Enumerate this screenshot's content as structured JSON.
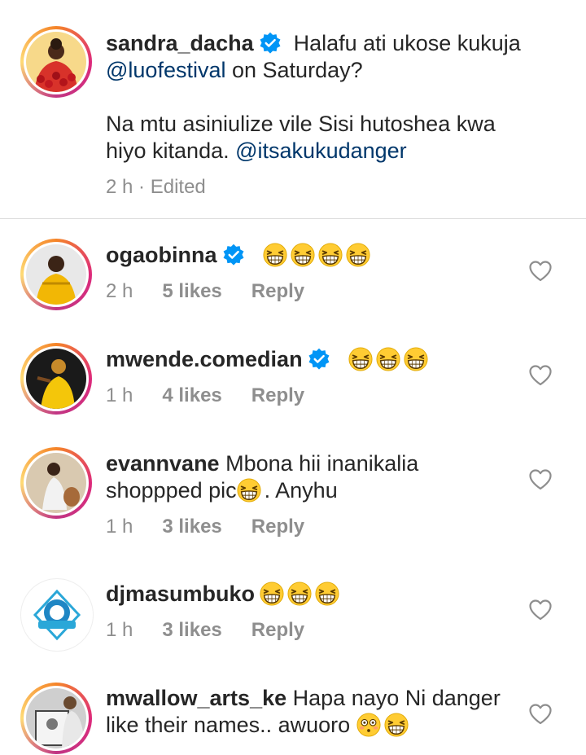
{
  "post": {
    "username": "sandra_dacha",
    "line1": "Halafu ati ukose kukuja",
    "mention1": "@luofestival",
    "line1b": "on Saturday?",
    "line2": "Na mtu asiniulize vile Sisi hutoshea kwa",
    "line3": "hiyo kitanda.",
    "mention2": "@itsakukudanger",
    "time": "2 h",
    "sep": "·",
    "edited": "Edited"
  },
  "comments": [
    {
      "username": "ogaobinna",
      "verified": true,
      "text": "",
      "emoji": [
        "grinning-squint-face",
        "grinning-squint-face",
        "grinning-squint-face",
        "grinning-squint-face"
      ],
      "time": "2 h",
      "likes": "5 likes",
      "reply": "Reply"
    },
    {
      "username": "mwende.comedian",
      "verified": true,
      "text": "",
      "emoji": [
        "grinning-squint-face",
        "grinning-squint-face",
        "grinning-squint-face"
      ],
      "time": "1 h",
      "likes": "4 likes",
      "reply": "Reply"
    },
    {
      "username": "evannvane",
      "verified": false,
      "text1": "Mbona hii inanikalia",
      "text2a": "shoppped pic",
      "text2b": ". Anyhu",
      "time": "1 h",
      "likes": "3 likes",
      "reply": "Reply"
    },
    {
      "username": "djmasumbuko",
      "verified": false,
      "emoji": [
        "grinning-squint-face",
        "grinning-squint-face",
        "grinning-squint-face"
      ],
      "time": "1 h",
      "likes": "3 likes",
      "reply": "Reply"
    },
    {
      "username": "mwallow_arts_ke",
      "verified": false,
      "text1": "Hapa nayo Ni danger",
      "text2": "like their names.. awuoro",
      "time": "",
      "likes": "",
      "reply": ""
    }
  ],
  "colors": {
    "link": "#00376b",
    "meta": "#8e8e8e",
    "verified": "#0095f6",
    "text": "#262626"
  },
  "icons": {
    "like": "heart-outline-icon",
    "verified": "verified-badge-icon"
  }
}
